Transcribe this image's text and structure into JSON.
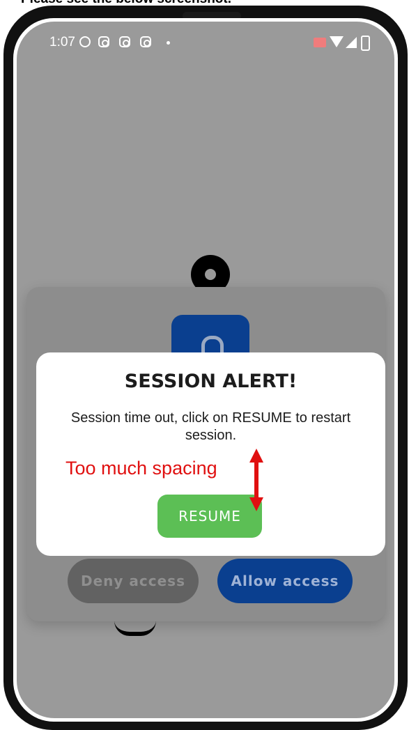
{
  "caption": "Please see the below screenshot.",
  "status_bar": {
    "time": "1:07",
    "icons": [
      "headset-icon",
      "instagram-icon",
      "instagram-icon",
      "instagram-icon",
      "dot-icon",
      "cast-icon",
      "wifi-icon",
      "signal-icon",
      "battery-icon"
    ]
  },
  "permission_card": {
    "deny_label": "Deny access",
    "allow_label": "Allow access",
    "lock_icon": "unlock-icon"
  },
  "dialog": {
    "title": "SESSION ALERT!",
    "message": "Session time out, click on RESUME to restart session.",
    "resume_label": "RESUME"
  },
  "annotation": {
    "text": "Too much spacing",
    "color": "#e01010"
  },
  "colors": {
    "primary_blue": "#0a3f8f",
    "resume_green": "#5cbf55",
    "overlay_gray": "#9a9a9a"
  }
}
